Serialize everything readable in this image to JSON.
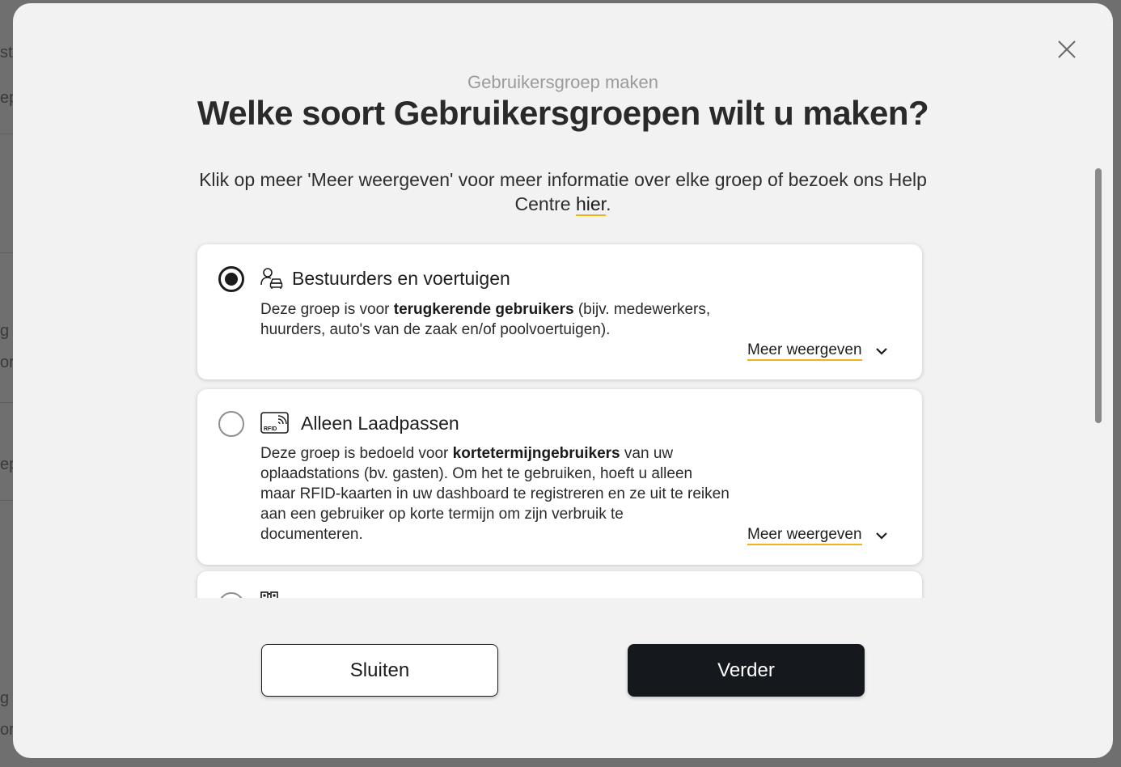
{
  "background": {
    "fragments": [
      "stu",
      "ep",
      "g g",
      "or",
      "ep",
      "g g",
      "or"
    ]
  },
  "modal": {
    "subtitle": "Gebruikersgroep maken",
    "title": "Welke soort Gebruikersgroepen wilt u maken?",
    "intro_text": "Klik op meer 'Meer weergeven' voor meer informatie over elke groep of bezoek ons Help Centre ",
    "intro_link": "hier",
    "intro_end": ".",
    "close_icon": "close-icon"
  },
  "options": [
    {
      "title": "Bestuurders en voertuigen",
      "icon": "driver-car-icon",
      "selected": true,
      "desc_pre": "Deze groep is voor ",
      "desc_bold": "terugkerende gebruikers",
      "desc_post": " (bijv. medewerkers, huurders, auto's van de zaak en/of poolvoertuigen).",
      "more": "Meer weergeven"
    },
    {
      "title": "Alleen Laadpassen",
      "icon": "rfid-card-icon",
      "icon_text": "RFID",
      "selected": false,
      "desc_pre": "Deze groep is bedoeld voor ",
      "desc_bold": "kortetermijngebruikers",
      "desc_post": " van uw oplaadstations (bv. gasten). Om het te gebruiken, hoeft u alleen maar RFID-kaarten in uw dashboard te registreren en ze uit te reiken aan een gebruiker op korte termijn om zijn verbruik te documenteren.",
      "more": "Meer weergeven"
    },
    {
      "title": "",
      "icon": "qr-code-icon",
      "selected": false
    }
  ],
  "buttons": {
    "close_label": "Sluiten",
    "next_label": "Verder"
  },
  "colors": {
    "accent_underline": "#f2b21a",
    "primary_button": "#15181d",
    "modal_bg": "#f2f2f2"
  }
}
